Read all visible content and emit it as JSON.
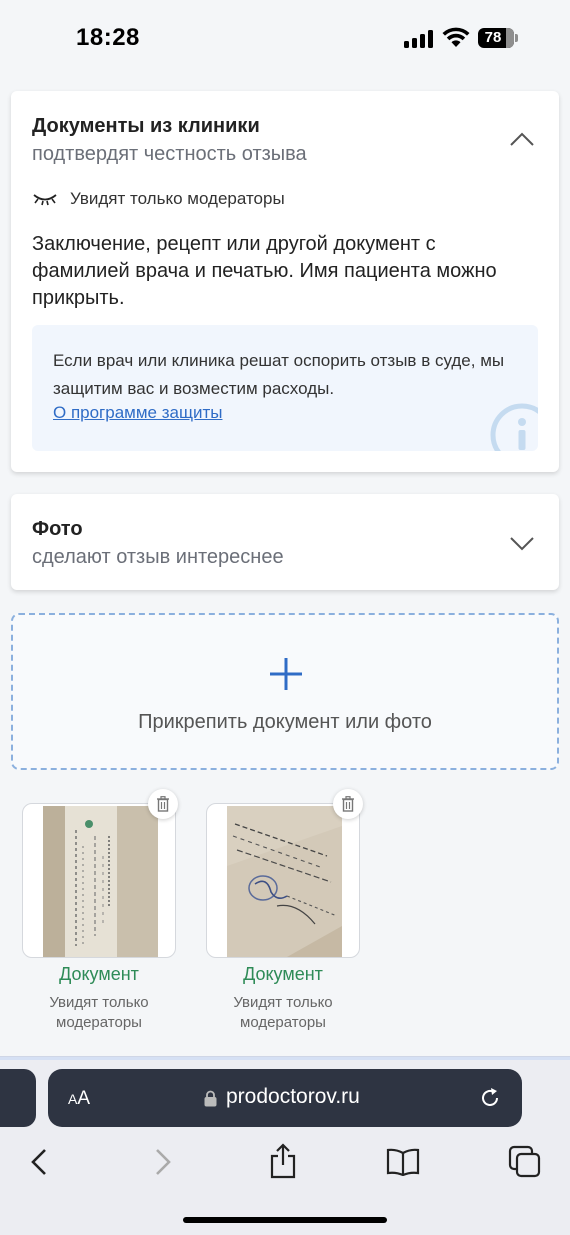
{
  "status_bar": {
    "time": "18:28",
    "battery": "78"
  },
  "documents_card": {
    "title": "Документы из клиники",
    "subtitle": "подтвердят честность отзыва",
    "visibility_note": "Увидят только модераторы",
    "description": "Заключение, рецепт или другой документ с фамилией врача и печатью. Имя пациента можно прикрыть.",
    "info_text": "Если врач или клиника решат оспорить отзыв в суде, мы защитим вас и возместим расходы.",
    "info_link": "О программе защиты"
  },
  "photo_card": {
    "title": "Фото",
    "subtitle": "сделают отзыв интереснее"
  },
  "upload": {
    "label": "Прикрепить документ или фото"
  },
  "attachments": [
    {
      "type_label": "Документ",
      "visibility": "Увидят только модераторы"
    },
    {
      "type_label": "Документ",
      "visibility": "Увидят только модераторы"
    }
  ],
  "browser": {
    "aa_label_small": "A",
    "aa_label_large": "A",
    "url": "prodoctorov.ru"
  },
  "colors": {
    "accent_blue": "#2f6cc6",
    "success_green": "#2e8b57",
    "info_bg": "#f1f6fd"
  }
}
